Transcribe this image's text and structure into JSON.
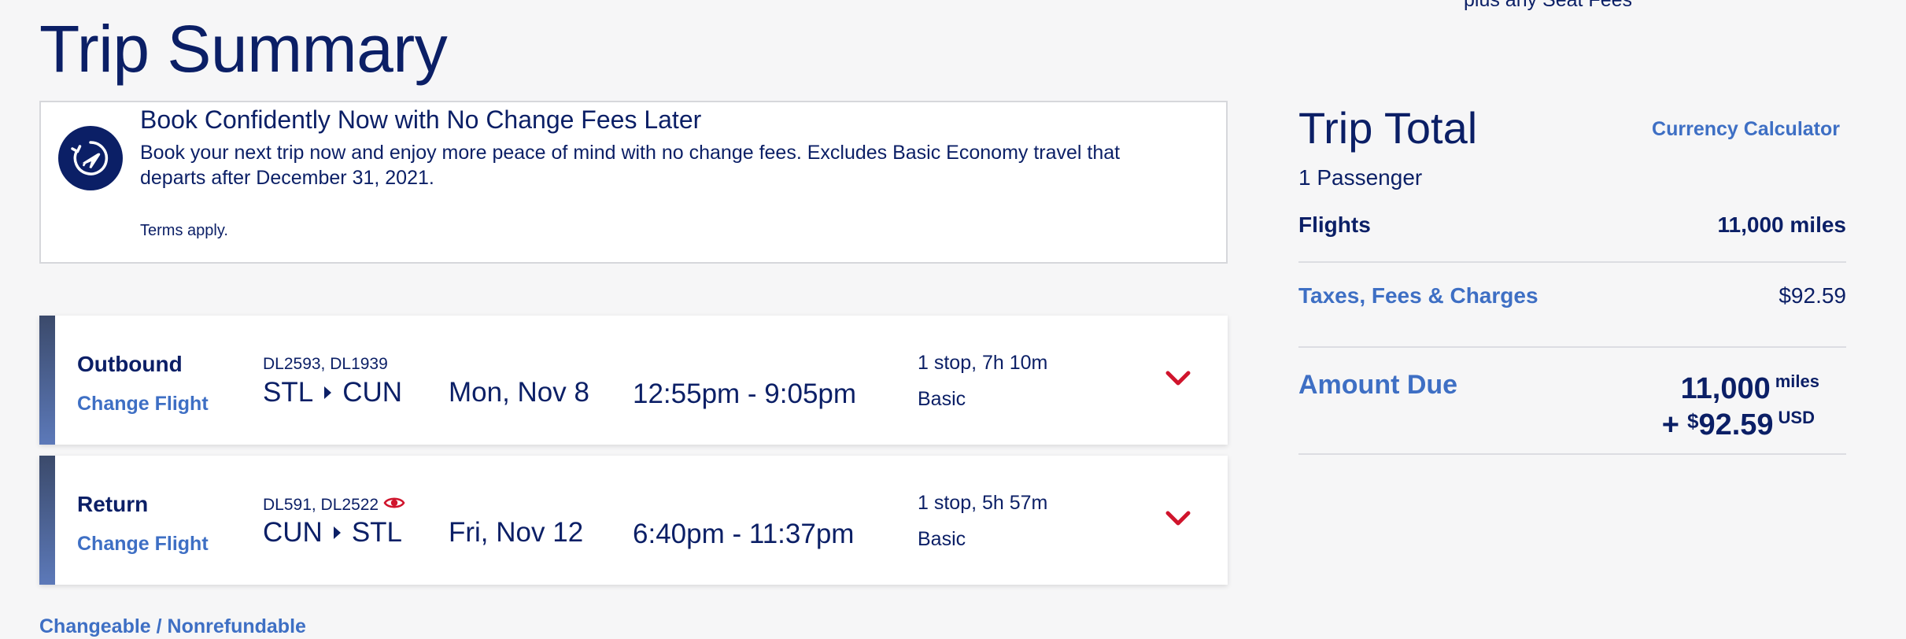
{
  "page": {
    "title": "Trip Summary",
    "top_cutoff_text": "plus any Seat Fees"
  },
  "banner": {
    "icon": "plane-clock-icon",
    "title": "Book Confidently Now with No Change Fees Later",
    "description": "Book your next trip now and enjoy more peace of mind with no change fees. Excludes Basic Economy travel that departs after December 31, 2021.",
    "terms": "Terms apply."
  },
  "flights": [
    {
      "direction": "Outbound",
      "change_label": "Change Flight",
      "flight_numbers": "DL2593, DL1939",
      "origin": "STL",
      "destination": "CUN",
      "date": "Mon, Nov 8",
      "time": "12:55pm - 9:05pm",
      "stops": "1 stop, 7h 10m",
      "fare_class": "Basic",
      "has_eye_icon": false
    },
    {
      "direction": "Return",
      "change_label": "Change Flight",
      "flight_numbers": "DL591, DL2522",
      "origin": "CUN",
      "destination": "STL",
      "date": "Fri, Nov 12",
      "time": "6:40pm - 11:37pm",
      "stops": "1 stop, 5h 57m",
      "fare_class": "Basic",
      "has_eye_icon": true
    }
  ],
  "footer": {
    "changeable": "Changeable / Nonrefundable"
  },
  "sidebar": {
    "title": "Trip Total",
    "currency_calculator": "Currency Calculator",
    "passengers": "1 Passenger",
    "flights_label": "Flights",
    "flights_value": "11,000 miles",
    "taxes_label": "Taxes, Fees & Charges",
    "taxes_value": "$92.59",
    "amount_due_label": "Amount Due",
    "amount_miles": "11,000",
    "amount_miles_unit": "miles",
    "amount_plus": "+",
    "amount_currency_symbol": "$",
    "amount_cash": "92.59",
    "amount_cash_unit": "USD"
  },
  "colors": {
    "navy": "#0b1f66",
    "link_blue": "#3e6fc4",
    "chevron_red": "#d0142c",
    "background": "#f6f6f7"
  }
}
